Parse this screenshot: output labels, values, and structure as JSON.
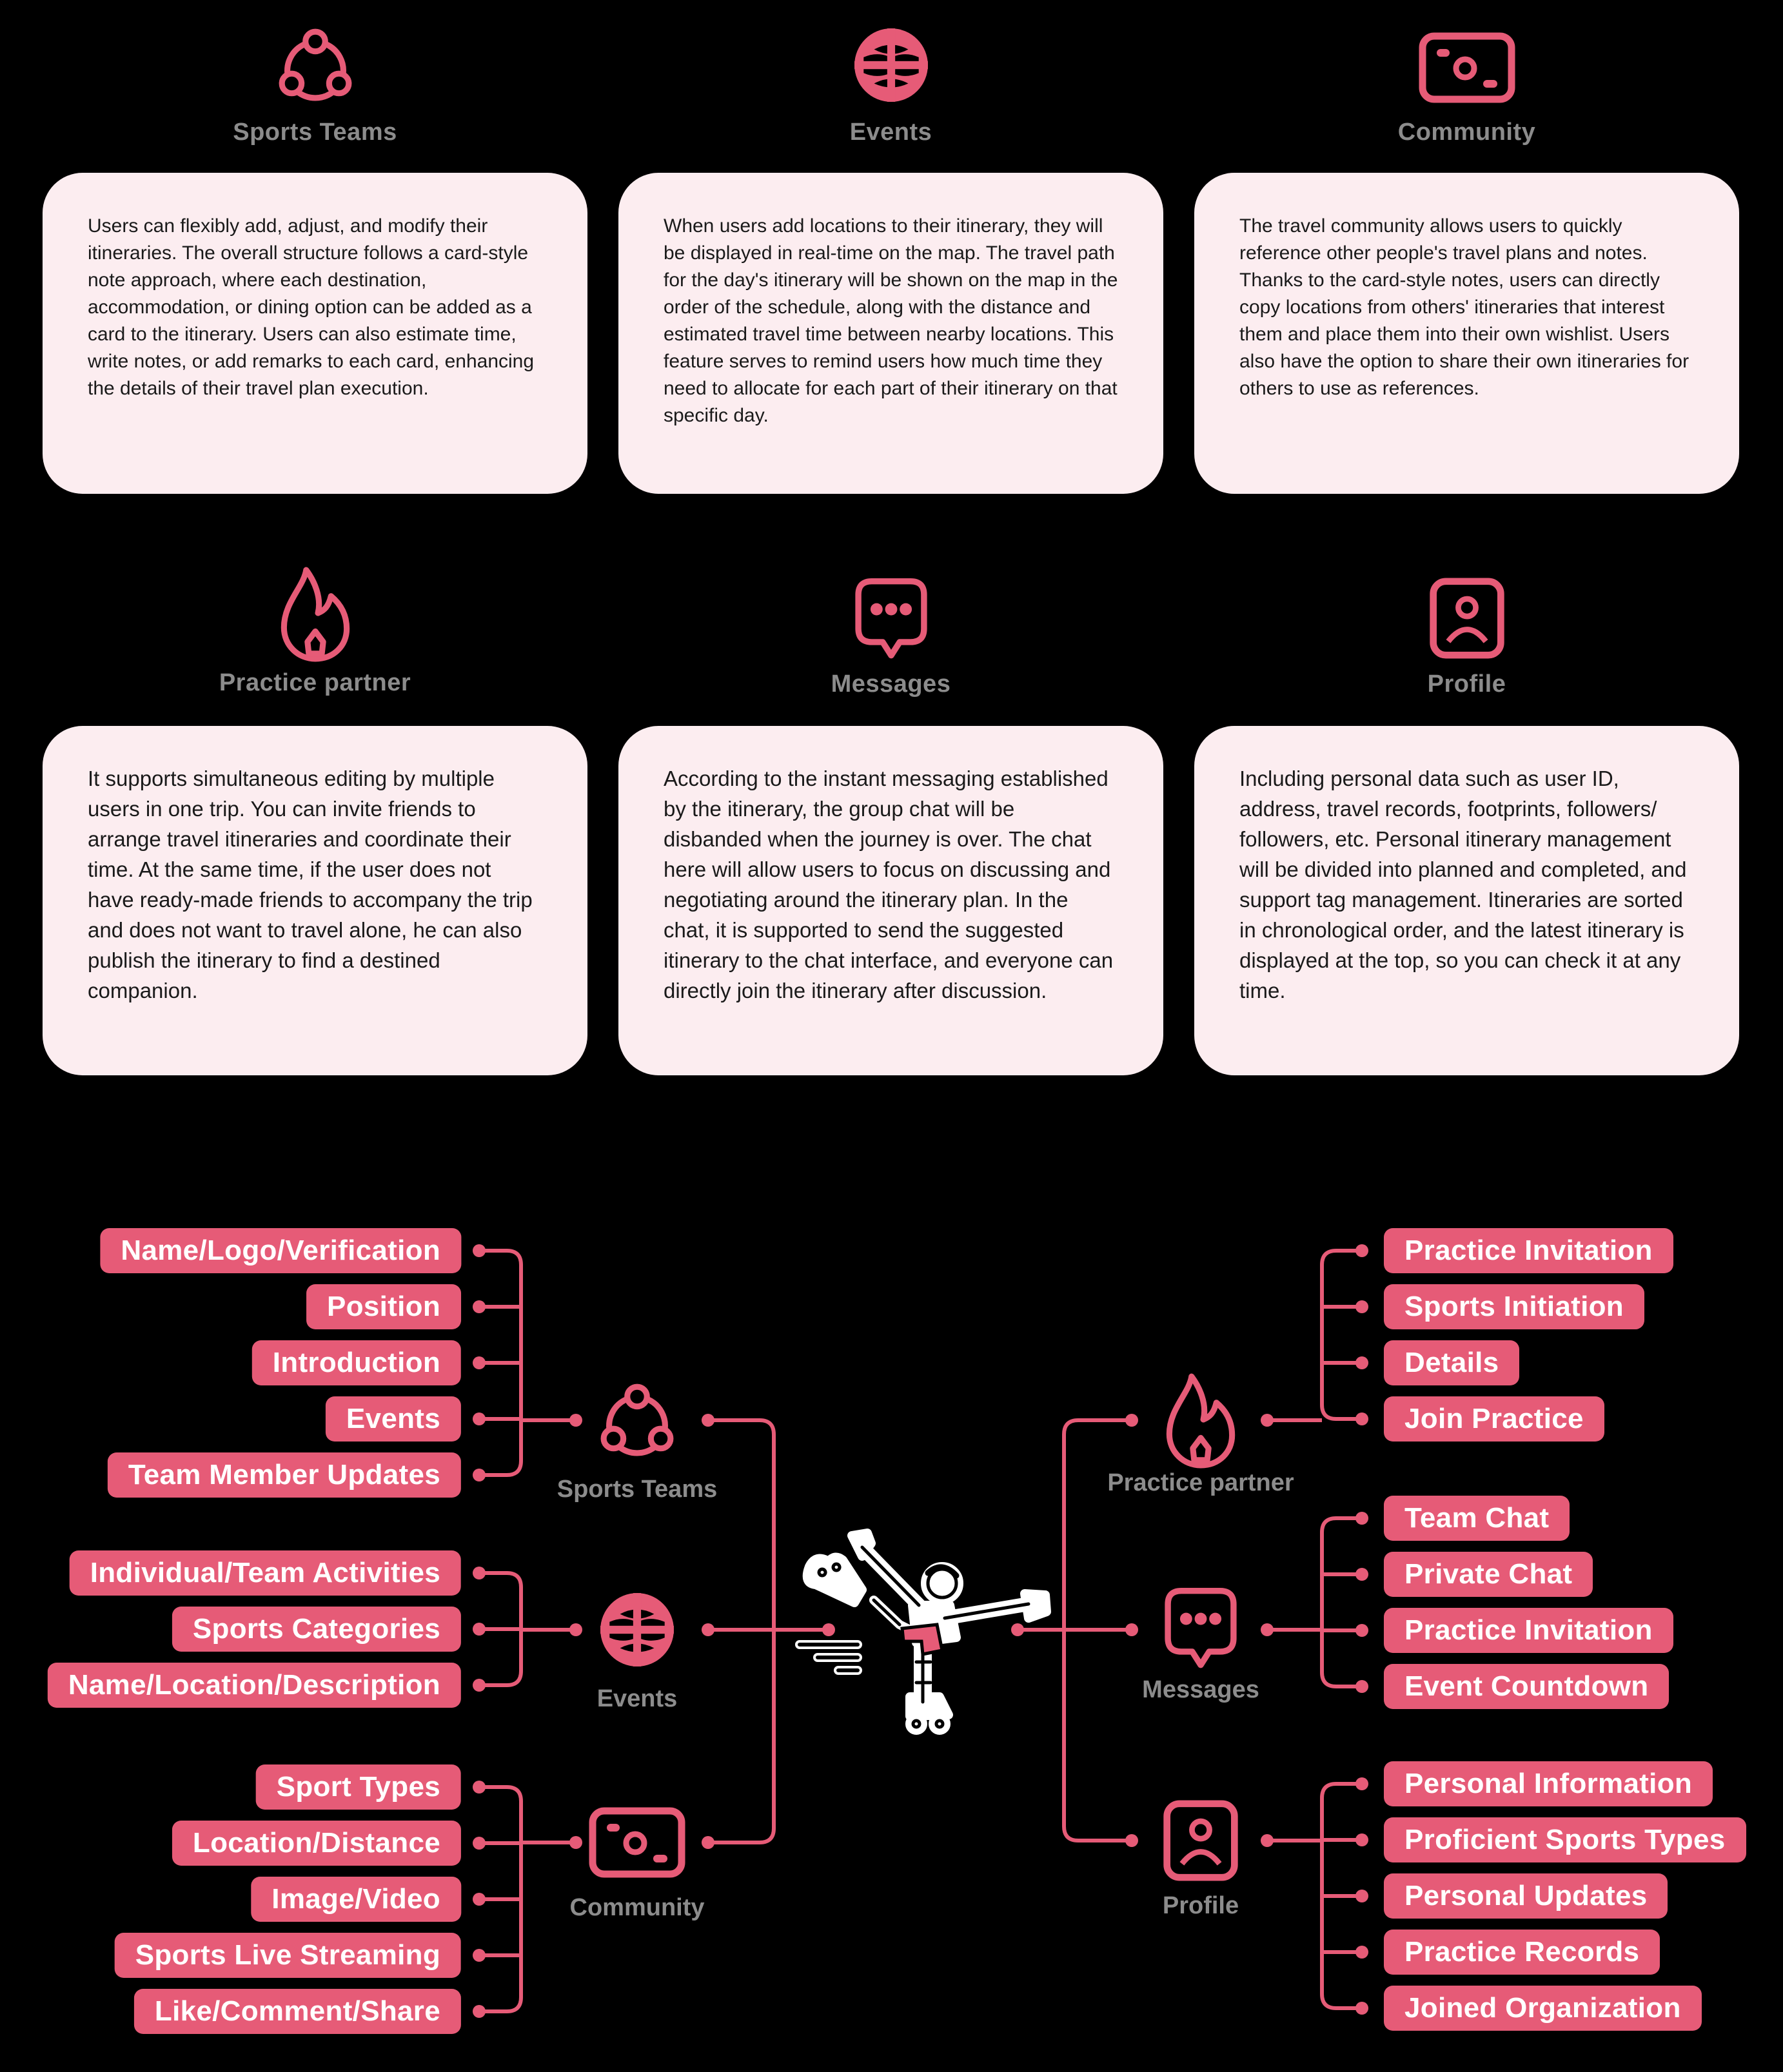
{
  "theme": {
    "accent": "#e65b77",
    "background": "#000000",
    "card_background": "#fcedf0",
    "label_gray": "#8c8c8c"
  },
  "features": [
    {
      "icon": "team-icon",
      "title": "Sports Teams",
      "description": "Users can flexibly add, adjust, and modify their itineraries. The overall structure follows a card-style note approach, where each destination, accommodation, or dining option can be added as a card to the itinerary. Users can also estimate time, write notes, or add remarks to each card, enhancing the details of their travel plan execution."
    },
    {
      "icon": "basketball-icon",
      "title": "Events",
      "description": "When users add locations to their itinerary, they will be displayed in real-time on the map. The travel path for the day's itinerary will be shown on the map in the order of the schedule, along with the distance and estimated travel time between nearby locations. This feature serves to remind users how much time they need to allocate for each part of their itinerary on that specific day."
    },
    {
      "icon": "camera-icon",
      "title": "Community",
      "description": "The travel community allows users to quickly reference other people's travel plans and notes. Thanks to the card-style notes, users can directly copy locations from others' itineraries that interest them and place them into their own wishlist. Users also have the option to share their own itineraries for others to use as references."
    },
    {
      "icon": "flame-icon",
      "title": "Practice partner",
      "description": "It supports simultaneous editing by multiple users in one trip. You can invite friends to arrange travel itineraries and coordinate their time. At the same time, if the user does not have ready-made friends to accompany the trip and does not want to travel alone, he can also publish the itinerary to find a destined companion."
    },
    {
      "icon": "chat-bubble-icon",
      "title": "Messages",
      "description": "According to the instant messaging established by the itinerary, the group chat will be disbanded when the journey is over. The chat here will allow users to focus on discussing and negotiating around the itinerary plan. In the chat, it is supported to send the suggested itinerary to the chat interface, and everyone can directly join the itinerary after discussion."
    },
    {
      "icon": "profile-icon",
      "title": "Profile",
      "description": "Including personal data such as user ID, address, travel records, footprints, followers/ followers, etc. Personal itinerary management will be divided into planned and completed, and support tag management. Itineraries are sorted in chronological order, and the latest itinerary is displayed at the top, so you can check it at any time."
    }
  ],
  "mindmap": {
    "center": "roller-skater-illustration",
    "left_branches": [
      {
        "title": "Sports Teams",
        "icon": "team-icon",
        "items": [
          "Name/Logo/Verification",
          "Position",
          "Introduction",
          "Events",
          "Team Member Updates"
        ]
      },
      {
        "title": "Events",
        "icon": "basketball-icon",
        "items": [
          "Individual/Team Activities",
          "Sports Categories",
          "Name/Location/Description"
        ]
      },
      {
        "title": "Community",
        "icon": "camera-icon",
        "items": [
          "Sport Types",
          "Location/Distance",
          "Image/Video",
          "Sports Live Streaming",
          "Like/Comment/Share"
        ]
      }
    ],
    "right_branches": [
      {
        "title": "Practice partner",
        "icon": "flame-icon",
        "items": [
          "Practice Invitation",
          "Sports Initiation",
          "Details",
          "Join Practice"
        ]
      },
      {
        "title": "Messages",
        "icon": "chat-bubble-icon",
        "items": [
          "Team Chat",
          "Private Chat",
          "Practice Invitation",
          "Event Countdown"
        ]
      },
      {
        "title": "Profile",
        "icon": "profile-icon",
        "items": [
          "Personal Information",
          "Proficient Sports Types",
          "Personal Updates",
          "Practice Records",
          "Joined Organization"
        ]
      }
    ]
  }
}
